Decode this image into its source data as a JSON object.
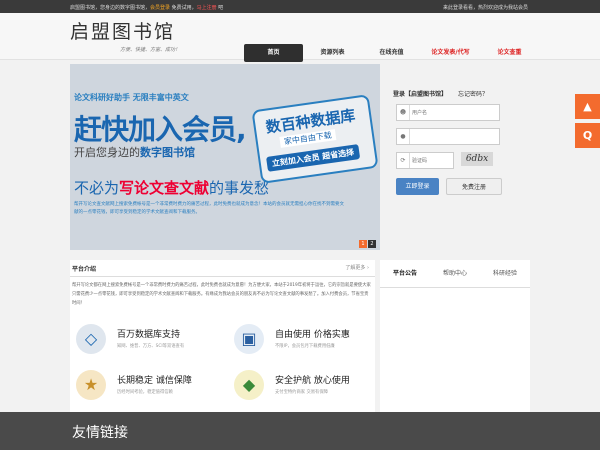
{
  "topbar": {
    "left_a": "启盟图书馆，您身边的数字图书馆，",
    "left_b": "会员登录",
    "left_c": " 免费试用，",
    "left_d": "马上注册",
    "left_e": " 吧",
    "right": "来此登录看看，热烈欢迎成为我站会员"
  },
  "header": {
    "logo": "启盟图书馆",
    "slogan": "方便、快捷、方富、成功！",
    "nav": [
      "首页",
      "资源列表",
      "在线充值",
      "论文发表/代写",
      "论文查重"
    ]
  },
  "banner": {
    "line1": "论文科研好助手 无限丰富中英文",
    "line2": "赶快加入会员,",
    "line3_a": "开启您身边的",
    "line3_b": "数字图书馆",
    "line4_a": "不必为",
    "line4_b": "写论文查文献",
    "line4_c": "的事发愁",
    "line5": "帮开写论文查文献网上搜索免费帐号是一个非常费时费力的痛苦过程，此时免费也就成为意念！本站的会员就无需担心你在找不到需要文献的一点零花钱，即可享受到稳定的学术文献查阅和下载服务。",
    "badge_big": "数百种数据库",
    "badge_mid": "家中自由下载",
    "badge_btns": "立刻加入会员 超省选择",
    "dots": [
      "1",
      "2"
    ]
  },
  "login": {
    "title": "登录【启盟图书馆】",
    "forgot": "忘记密码？",
    "username_placeholder": "用户名",
    "password_placeholder": "",
    "captcha_placeholder": "验证码",
    "captcha_text": "6dbx",
    "login_btn": "立即登录",
    "register_btn": "免费注册"
  },
  "side_tools": {
    "top_label": "▲",
    "qq_label": "Q"
  },
  "intro": {
    "heading": "平台介绍",
    "more": "了解更多 ›",
    "text": "帮开写论文都在网上搜索免费帐号是一个非常费时费力的痛苦过程，此时免费也就成为意愿！为方便大家，本站于2019年初将于运往，它的宗旨就是要使大家只需花费少一点零花钱，即可享受到稳定的学术文献查阅和下载服务。有缘成为我站会员的朋友再不必为写论文查文献的事发愁了。加入付费会员，节省宝贵时间！",
    "features": [
      {
        "icon": "database-icon",
        "title": "百万数据库支持",
        "sub": "知网、维普、万方、SCI等双语查有"
      },
      {
        "icon": "monitor-icon",
        "title": "自由使用 价格实惠",
        "sub": "不限IP，会员包月下载费用低廉"
      },
      {
        "icon": "medal-icon",
        "title": "长期稳定 诚信保障",
        "sub": "历经时间考验，稳定值得信赖"
      },
      {
        "icon": "shield-icon",
        "title": "安全护航 放心使用",
        "sub": "支付宝特约商家 交易有保障"
      }
    ]
  },
  "tabs": [
    "平台公告",
    "帮助中心",
    "科研经验"
  ],
  "footer": {
    "title": "友情链接"
  },
  "colors": {
    "accent_blue": "#4a83c4",
    "nav_active": "#2f2f2f",
    "side_orange": "#f36b2e",
    "red": "#dd2222"
  }
}
